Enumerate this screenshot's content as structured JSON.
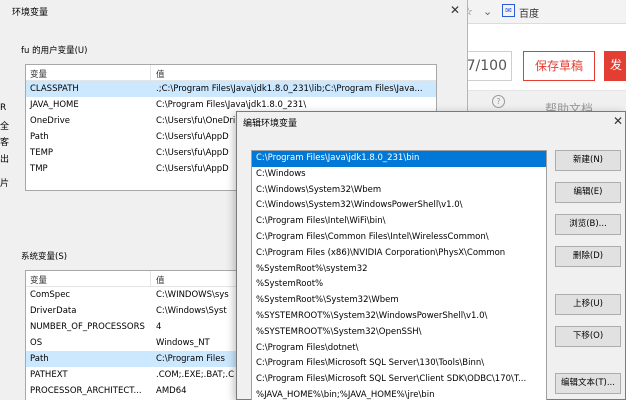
{
  "browser": {
    "search_engine": "百度",
    "counter": "7/100",
    "save_draft": "保存草稿",
    "publish": "发",
    "help": "帮助文档",
    "help_icon_glyph": "?"
  },
  "env_window": {
    "title": "环境变量",
    "user_group_label": "fu 的用户变量(U)",
    "system_group_label": "系统变量(S)",
    "col_var": "变量",
    "col_val": "值",
    "user_vars": [
      {
        "name": "CLASSPATH",
        "value": ".;C:\\Program Files\\Java\\jdk1.8.0_231\\lib;C:\\Program Files\\Java..."
      },
      {
        "name": "JAVA_HOME",
        "value": "C:\\Program Files\\Java\\jdk1.8.0_231\\"
      },
      {
        "name": "OneDrive",
        "value": "C:\\Users\\fu\\OneDri"
      },
      {
        "name": "Path",
        "value": "C:\\Users\\fu\\AppD"
      },
      {
        "name": "TEMP",
        "value": "C:\\Users\\fu\\AppD"
      },
      {
        "name": "TMP",
        "value": "C:\\Users\\fu\\AppD"
      }
    ],
    "system_vars": [
      {
        "name": "ComSpec",
        "value": "C:\\WINDOWS\\sys"
      },
      {
        "name": "DriverData",
        "value": "C:\\Windows\\Syst"
      },
      {
        "name": "NUMBER_OF_PROCESSORS",
        "value": "4"
      },
      {
        "name": "OS",
        "value": "Windows_NT"
      },
      {
        "name": "Path",
        "value": "C:\\Program Files"
      },
      {
        "name": "PATHEXT",
        "value": ".COM;.EXE;.BAT;.C"
      },
      {
        "name": "PROCESSOR_ARCHITECT...",
        "value": "AMD64"
      }
    ],
    "left_edge_glyphs": [
      "R",
      "全",
      "客",
      "出",
      "片"
    ]
  },
  "edit_dialog": {
    "title": "编辑环境变量",
    "paths": [
      "C:\\Program Files\\Java\\jdk1.8.0_231\\bin",
      "C:\\Windows",
      "C:\\Windows\\System32\\Wbem",
      "C:\\Windows\\System32\\WindowsPowerShell\\v1.0\\",
      "C:\\Program Files\\Intel\\WiFi\\bin\\",
      "C:\\Program Files\\Common Files\\Intel\\WirelessCommon\\",
      "C:\\Program Files (x86)\\NVIDIA Corporation\\PhysX\\Common",
      "%SystemRoot%\\system32",
      "%SystemRoot%",
      "%SystemRoot%\\System32\\Wbem",
      "%SYSTEMROOT%\\System32\\WindowsPowerShell\\v1.0\\",
      "%SYSTEMROOT%\\System32\\OpenSSH\\",
      "C:\\Program Files\\dotnet\\",
      "C:\\Program Files\\Microsoft SQL Server\\130\\Tools\\Binn\\",
      "C:\\Program Files\\Microsoft SQL Server\\Client SDK\\ODBC\\170\\T...",
      "%JAVA_HOME%\\bin;%JAVA_HOME%\\jre\\bin"
    ],
    "buttons": {
      "new": "新建(N)",
      "edit": "编辑(E)",
      "browse": "浏览(B)...",
      "delete": "删除(D)",
      "move_up": "上移(U)",
      "move_down": "下移(O)",
      "edit_text": "编辑文本(T)..."
    }
  },
  "colors": {
    "selection_blue": "#0078d7",
    "light_selection": "#cce8ff",
    "accent_red": "#e33e33"
  }
}
